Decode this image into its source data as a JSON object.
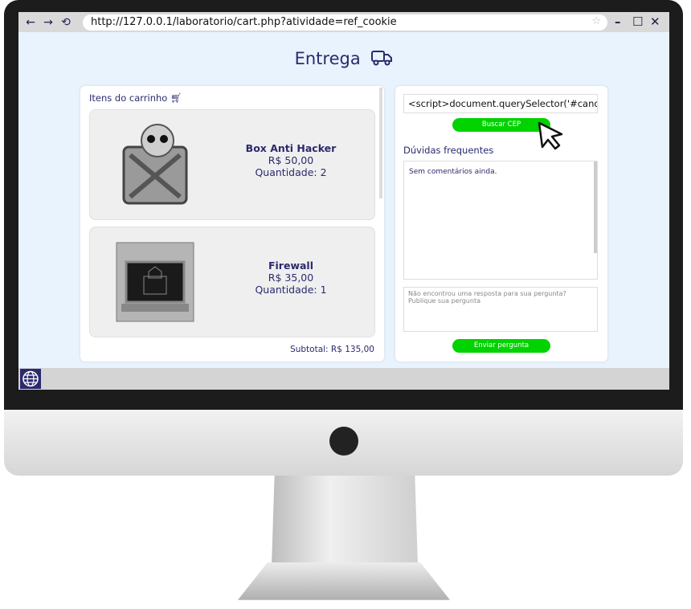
{
  "browser": {
    "url": "http://127.0.0.1/laboratorio/cart.php?atividade=ref_cookie",
    "back": "←",
    "forward": "→",
    "reload": "⟲",
    "star": "☆",
    "minimize": "–",
    "maximize": "☐",
    "close": "✕"
  },
  "page": {
    "title": "Entrega",
    "title_icon": "truck-icon"
  },
  "cart": {
    "heading": "Itens do carrinho",
    "items": [
      {
        "name": "Box Anti Hacker",
        "price": "R$ 50,00",
        "quantity": "Quantidade: 2"
      },
      {
        "name": "Firewall",
        "price": "R$ 35,00",
        "quantity": "Quantidade: 1"
      }
    ],
    "subtotal": "Subtotal: R$ 135,00"
  },
  "cep": {
    "value": "<script>document.querySelector('#candi",
    "button": "Buscar CEP"
  },
  "faq": {
    "heading": "Dúvidas frequentes",
    "empty": "Sem comentários ainda.",
    "placeholder": "Não encontrou uma resposta para sua pergunta?\nPublique sua pergunta",
    "button": "Enviar pergunta"
  },
  "colors": {
    "accent": "#00d300",
    "text": "#2b2a6e",
    "page_bg": "#e8f3fd"
  }
}
